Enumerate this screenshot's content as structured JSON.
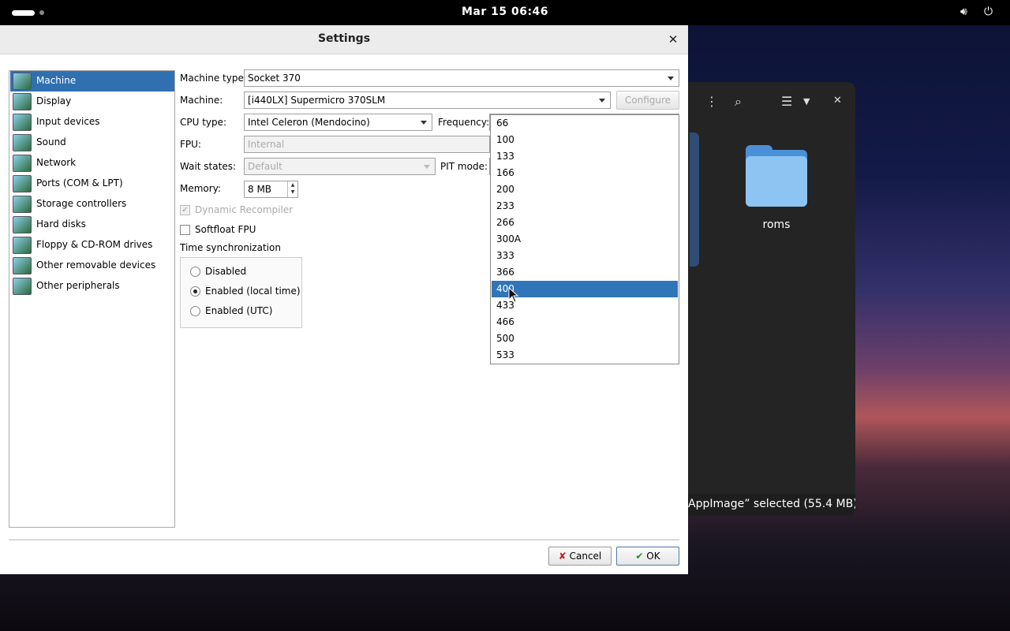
{
  "topbar": {
    "clock": "Mar 15  06:46"
  },
  "file_window": {
    "folder_name": "roms",
    "status": "AppImage” selected  (55.4 MB)"
  },
  "dialog": {
    "title": "Settings",
    "categories": [
      {
        "label": "Machine",
        "selected": true
      },
      {
        "label": "Display",
        "selected": false
      },
      {
        "label": "Input devices",
        "selected": false
      },
      {
        "label": "Sound",
        "selected": false
      },
      {
        "label": "Network",
        "selected": false
      },
      {
        "label": "Ports (COM & LPT)",
        "selected": false
      },
      {
        "label": "Storage controllers",
        "selected": false
      },
      {
        "label": "Hard disks",
        "selected": false
      },
      {
        "label": "Floppy & CD-ROM drives",
        "selected": false
      },
      {
        "label": "Other removable devices",
        "selected": false
      },
      {
        "label": "Other peripherals",
        "selected": false
      }
    ],
    "machine_type": {
      "label": "Machine type:",
      "value": "Socket 370"
    },
    "machine": {
      "label": "Machine:",
      "value": "[i440LX] Supermicro 370SLM",
      "configure": "Configure"
    },
    "cpu_type": {
      "label": "CPU type:",
      "value": "Intel Celeron (Mendocino)"
    },
    "frequency": {
      "label": "Frequency:",
      "selected": "400"
    },
    "fpu": {
      "label": "FPU:",
      "value": "Internal"
    },
    "wait_states": {
      "label": "Wait states:",
      "value": "Default"
    },
    "pit_mode": {
      "label": "PIT mode:"
    },
    "memory": {
      "label": "Memory:",
      "value": "8 MB"
    },
    "dynamic_recompiler": {
      "label": "Dynamic Recompiler",
      "checked": true,
      "disabled": true
    },
    "softfloat_fpu": {
      "label": "Softfloat FPU",
      "checked": false
    },
    "time_sync": {
      "label": "Time synchronization",
      "options": [
        {
          "label": "Disabled",
          "selected": false
        },
        {
          "label": "Enabled (local time)",
          "selected": true
        },
        {
          "label": "Enabled (UTC)",
          "selected": false
        }
      ]
    },
    "buttons": {
      "cancel": "Cancel",
      "ok": "OK"
    }
  },
  "frequency_options": [
    "66",
    "100",
    "133",
    "166",
    "200",
    "233",
    "266",
    "300A",
    "333",
    "366",
    "400",
    "433",
    "466",
    "500",
    "533"
  ]
}
